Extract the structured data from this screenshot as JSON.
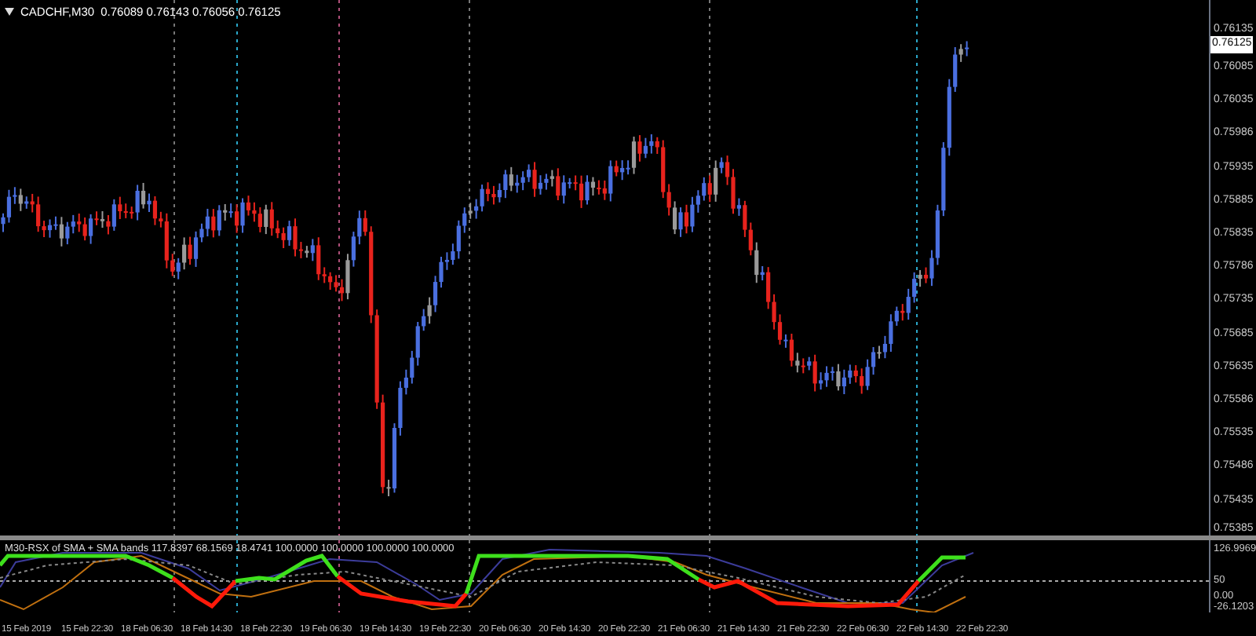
{
  "header": {
    "symbol": "CADCHF,M30",
    "quote": "0.76089 0.76143 0.76056 0.76125"
  },
  "price_axis": {
    "top_label": "0.76135",
    "current_price": "0.76125",
    "labels": [
      "0.76085",
      "0.76035",
      "0.75986",
      "0.75935",
      "0.75885",
      "0.75835",
      "0.75786",
      "0.75735",
      "0.75685",
      "0.75635",
      "0.75586",
      "0.75535",
      "0.75486",
      "0.75435"
    ],
    "bottom_label": "0.75385"
  },
  "indicator": {
    "label": "M30-RSX of SMA  + SMA bands 117.8397 68.1569 18.4741 100.0000 100.0000 100.0000 100.0000",
    "axis_labels": [
      "126.9969",
      "50",
      "0.00",
      "-26.1203"
    ]
  },
  "time_axis": [
    "15 Feb 2019",
    "15 Feb 22:30",
    "18 Feb 06:30",
    "18 Feb 14:30",
    "18 Feb 22:30",
    "19 Feb 06:30",
    "19 Feb 14:30",
    "19 Feb 22:30",
    "20 Feb 06:30",
    "20 Feb 14:30",
    "20 Feb 22:30",
    "21 Feb 06:30",
    "21 Feb 14:30",
    "21 Feb 22:30",
    "22 Feb 06:30",
    "22 Feb 14:30",
    "22 Feb 22:30"
  ]
}
